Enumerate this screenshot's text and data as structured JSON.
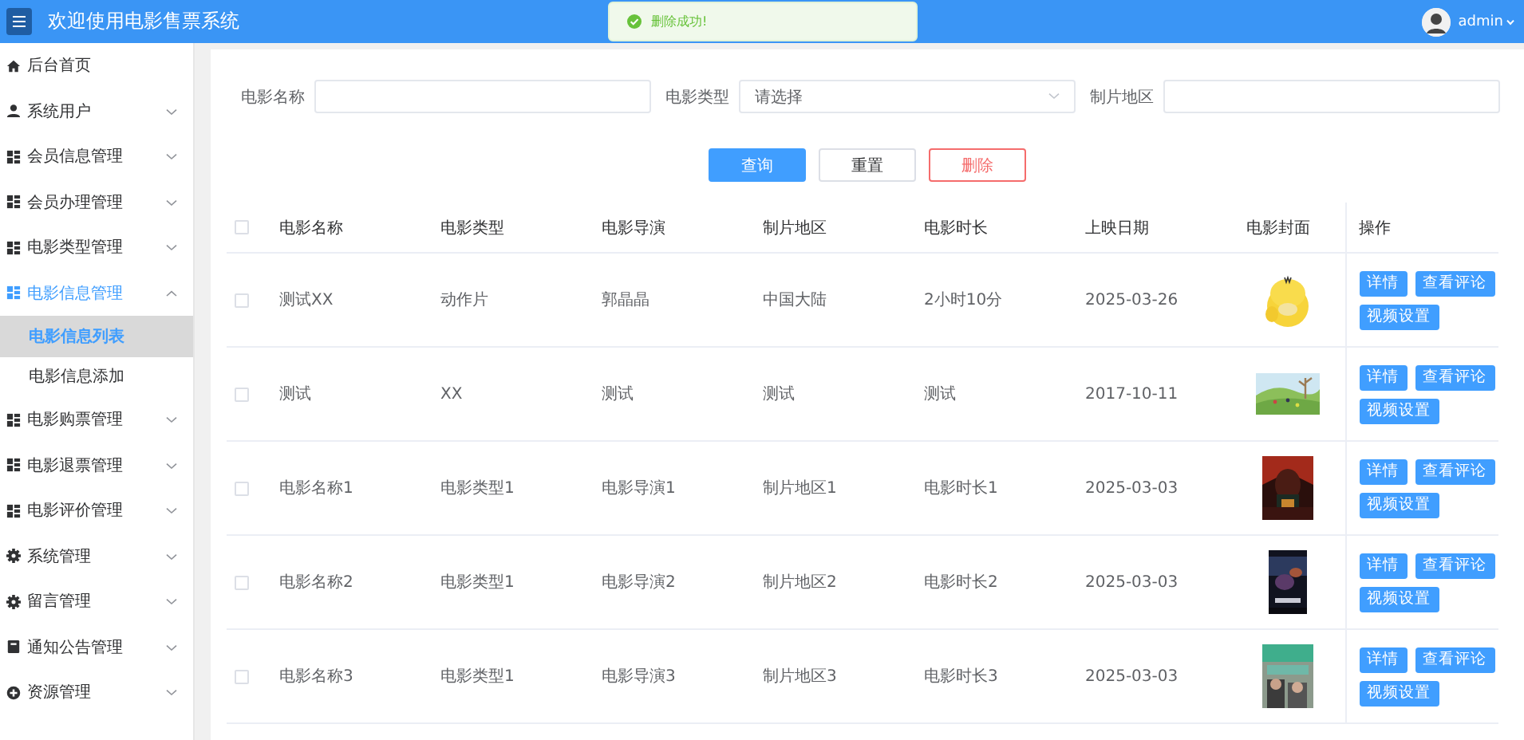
{
  "header": {
    "title": "欢迎使用电影售票系统",
    "user": "admin"
  },
  "toast": {
    "kind": "success",
    "message": "删除成功!"
  },
  "sidebar": {
    "items": [
      {
        "label": "后台首页",
        "kind": "link"
      },
      {
        "label": "系统用户",
        "kind": "menu",
        "expanded": false
      },
      {
        "label": "会员信息管理",
        "kind": "menu",
        "expanded": false
      },
      {
        "label": "会员办理管理",
        "kind": "menu",
        "expanded": false
      },
      {
        "label": "电影类型管理",
        "kind": "menu",
        "expanded": false
      },
      {
        "label": "电影信息管理",
        "kind": "menu",
        "expanded": true,
        "children": [
          {
            "label": "电影信息列表",
            "selected": true
          },
          {
            "label": "电影信息添加",
            "selected": false
          }
        ]
      },
      {
        "label": "电影购票管理",
        "kind": "menu",
        "expanded": false
      },
      {
        "label": "电影退票管理",
        "kind": "menu",
        "expanded": false
      },
      {
        "label": "电影评价管理",
        "kind": "menu",
        "expanded": false
      },
      {
        "label": "系统管理",
        "kind": "menu",
        "expanded": false
      },
      {
        "label": "留言管理",
        "kind": "menu",
        "expanded": false
      },
      {
        "label": "通知公告管理",
        "kind": "menu",
        "expanded": false
      },
      {
        "label": "资源管理",
        "kind": "menu",
        "expanded": false
      }
    ]
  },
  "search": {
    "fields": [
      {
        "label": "电影名称",
        "kind": "input"
      },
      {
        "label": "电影类型",
        "kind": "select",
        "placeholder": "请选择"
      },
      {
        "label": "制片地区",
        "kind": "input"
      }
    ],
    "buttons": [
      {
        "label": "查询",
        "kind": "primary"
      },
      {
        "label": "重置",
        "kind": "default"
      },
      {
        "label": "删除",
        "kind": "danger"
      }
    ]
  },
  "table": {
    "select_all_checked": false,
    "columns": [
      "电影名称",
      "电影类型",
      "电影导演",
      "制片地区",
      "电影时长",
      "上映日期",
      "电影封面",
      "操作"
    ],
    "rows": [
      {
        "checked": false,
        "cells": [
          "测试XX",
          "动作片",
          "郭晶晶",
          "中国大陆",
          "2小时10分",
          "2025-03-26"
        ],
        "actions": [
          "详情",
          "查看评论",
          "视频设置"
        ]
      },
      {
        "checked": false,
        "cells": [
          "测试",
          "XX",
          "测试",
          "测试",
          "测试",
          "2017-10-11"
        ],
        "actions": [
          "详情",
          "查看评论",
          "视频设置"
        ]
      },
      {
        "checked": false,
        "cells": [
          "电影名称1",
          "电影类型1",
          "电影导演1",
          "制片地区1",
          "电影时长1",
          "2025-03-03"
        ],
        "actions": [
          "详情",
          "查看评论",
          "视频设置"
        ]
      },
      {
        "checked": false,
        "cells": [
          "电影名称2",
          "电影类型1",
          "电影导演2",
          "制片地区2",
          "电影时长2",
          "2025-03-03"
        ],
        "actions": [
          "详情",
          "查看评论",
          "视频设置"
        ]
      },
      {
        "checked": false,
        "cells": [
          "电影名称3",
          "电影类型1",
          "电影导演3",
          "制片地区3",
          "电影时长3",
          "2025-03-03"
        ],
        "actions": [
          "详情",
          "查看评论",
          "视频设置"
        ]
      }
    ]
  }
}
